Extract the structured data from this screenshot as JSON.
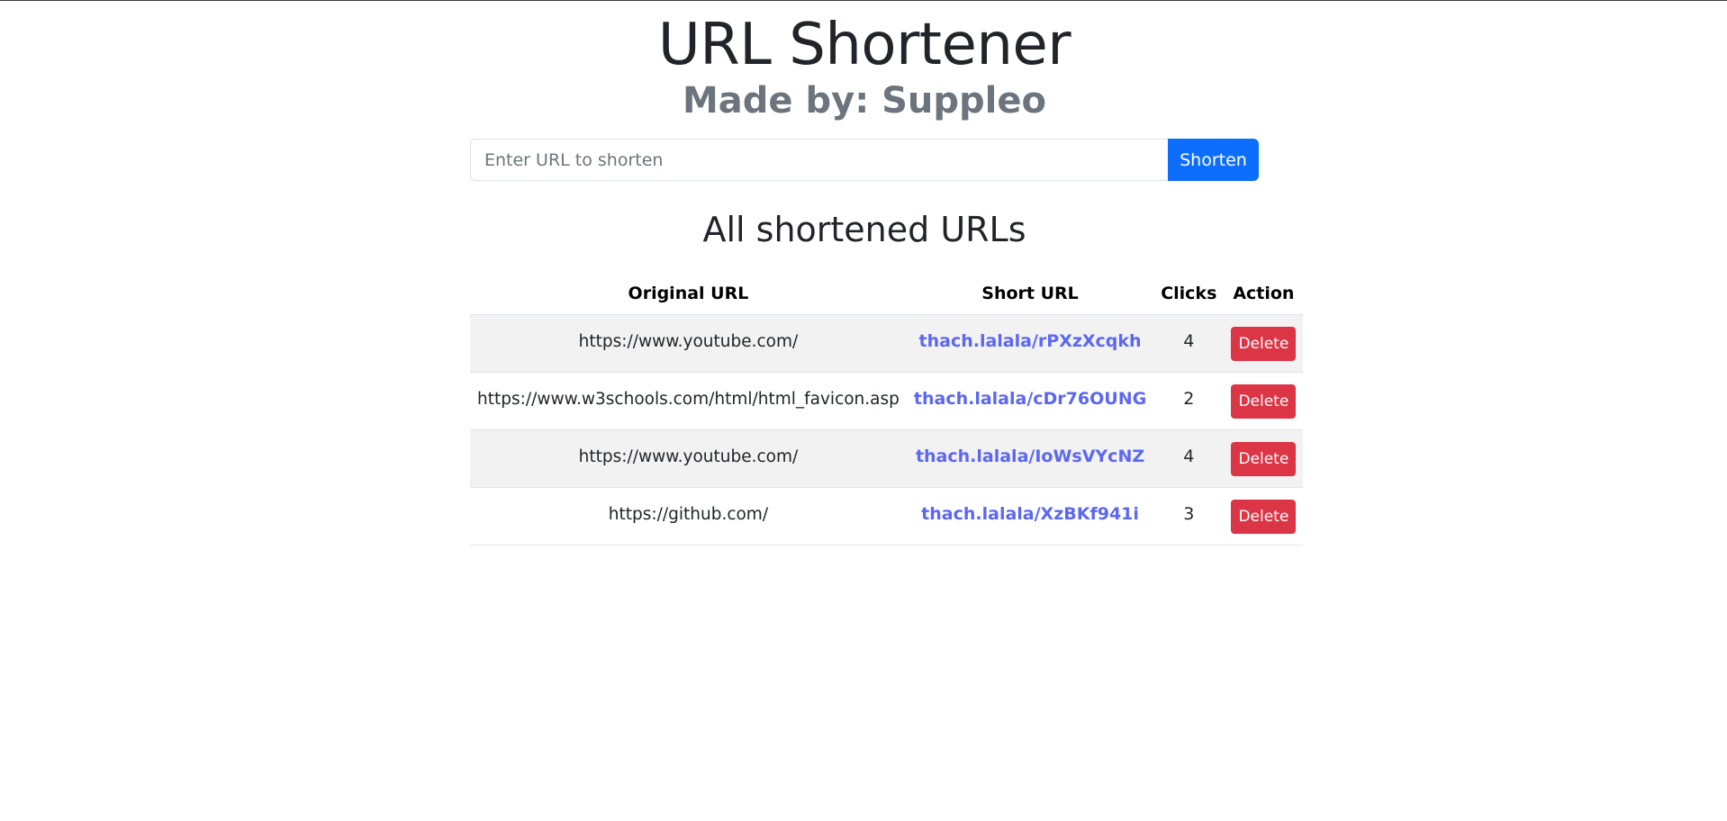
{
  "header": {
    "title": "URL Shortener",
    "subtitle": "Made by: Suppleo"
  },
  "form": {
    "input_placeholder": "Enter URL to shorten",
    "input_value": "",
    "submit_label": "Shorten"
  },
  "list": {
    "title": "All shortened URLs",
    "columns": [
      "Original URL",
      "Short URL",
      "Clicks",
      "Action"
    ],
    "rows": [
      {
        "original": "https://www.youtube.com/",
        "short": "thach.lalala/rPXzXcqkh",
        "clicks": "4",
        "action": "Delete"
      },
      {
        "original": "https://www.w3schools.com/html/html_favicon.asp",
        "short": "thach.lalala/cDr76OUNG",
        "clicks": "2",
        "action": "Delete"
      },
      {
        "original": "https://www.youtube.com/",
        "short": "thach.lalala/IoWsVYcNZ",
        "clicks": "4",
        "action": "Delete"
      },
      {
        "original": "https://github.com/",
        "short": "thach.lalala/XzBKf941i",
        "clicks": "3",
        "action": "Delete"
      }
    ]
  },
  "colors": {
    "primary": "#0d6efd",
    "danger": "#dc3545",
    "link": "#5c67f2",
    "muted": "#6c757d"
  }
}
